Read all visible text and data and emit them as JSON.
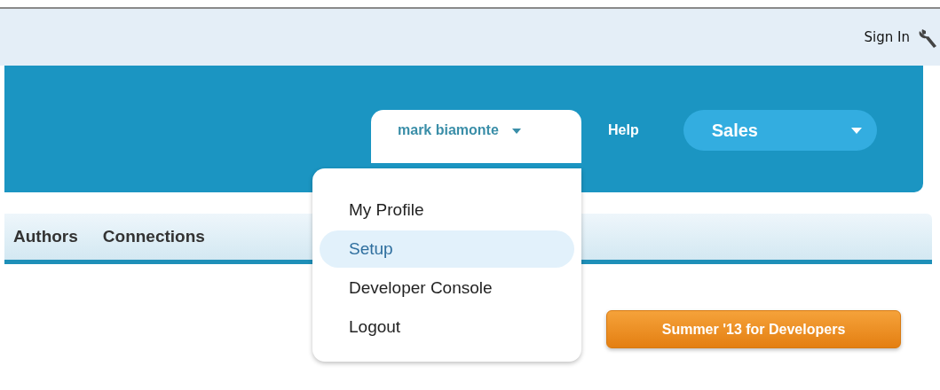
{
  "top_bar": {
    "sign_in": "Sign In"
  },
  "header": {
    "user_menu": "mark biamonte",
    "help": "Help",
    "app_menu": "Sales"
  },
  "tabs": [
    {
      "label": "Authors"
    },
    {
      "label": "Connections"
    }
  ],
  "user_dropdown": [
    {
      "label": "My Profile",
      "selected": false
    },
    {
      "label": "Setup",
      "selected": true
    },
    {
      "label": "Developer Console",
      "selected": false
    },
    {
      "label": "Logout",
      "selected": false
    }
  ],
  "release_button": "Summer '13 for Developers"
}
